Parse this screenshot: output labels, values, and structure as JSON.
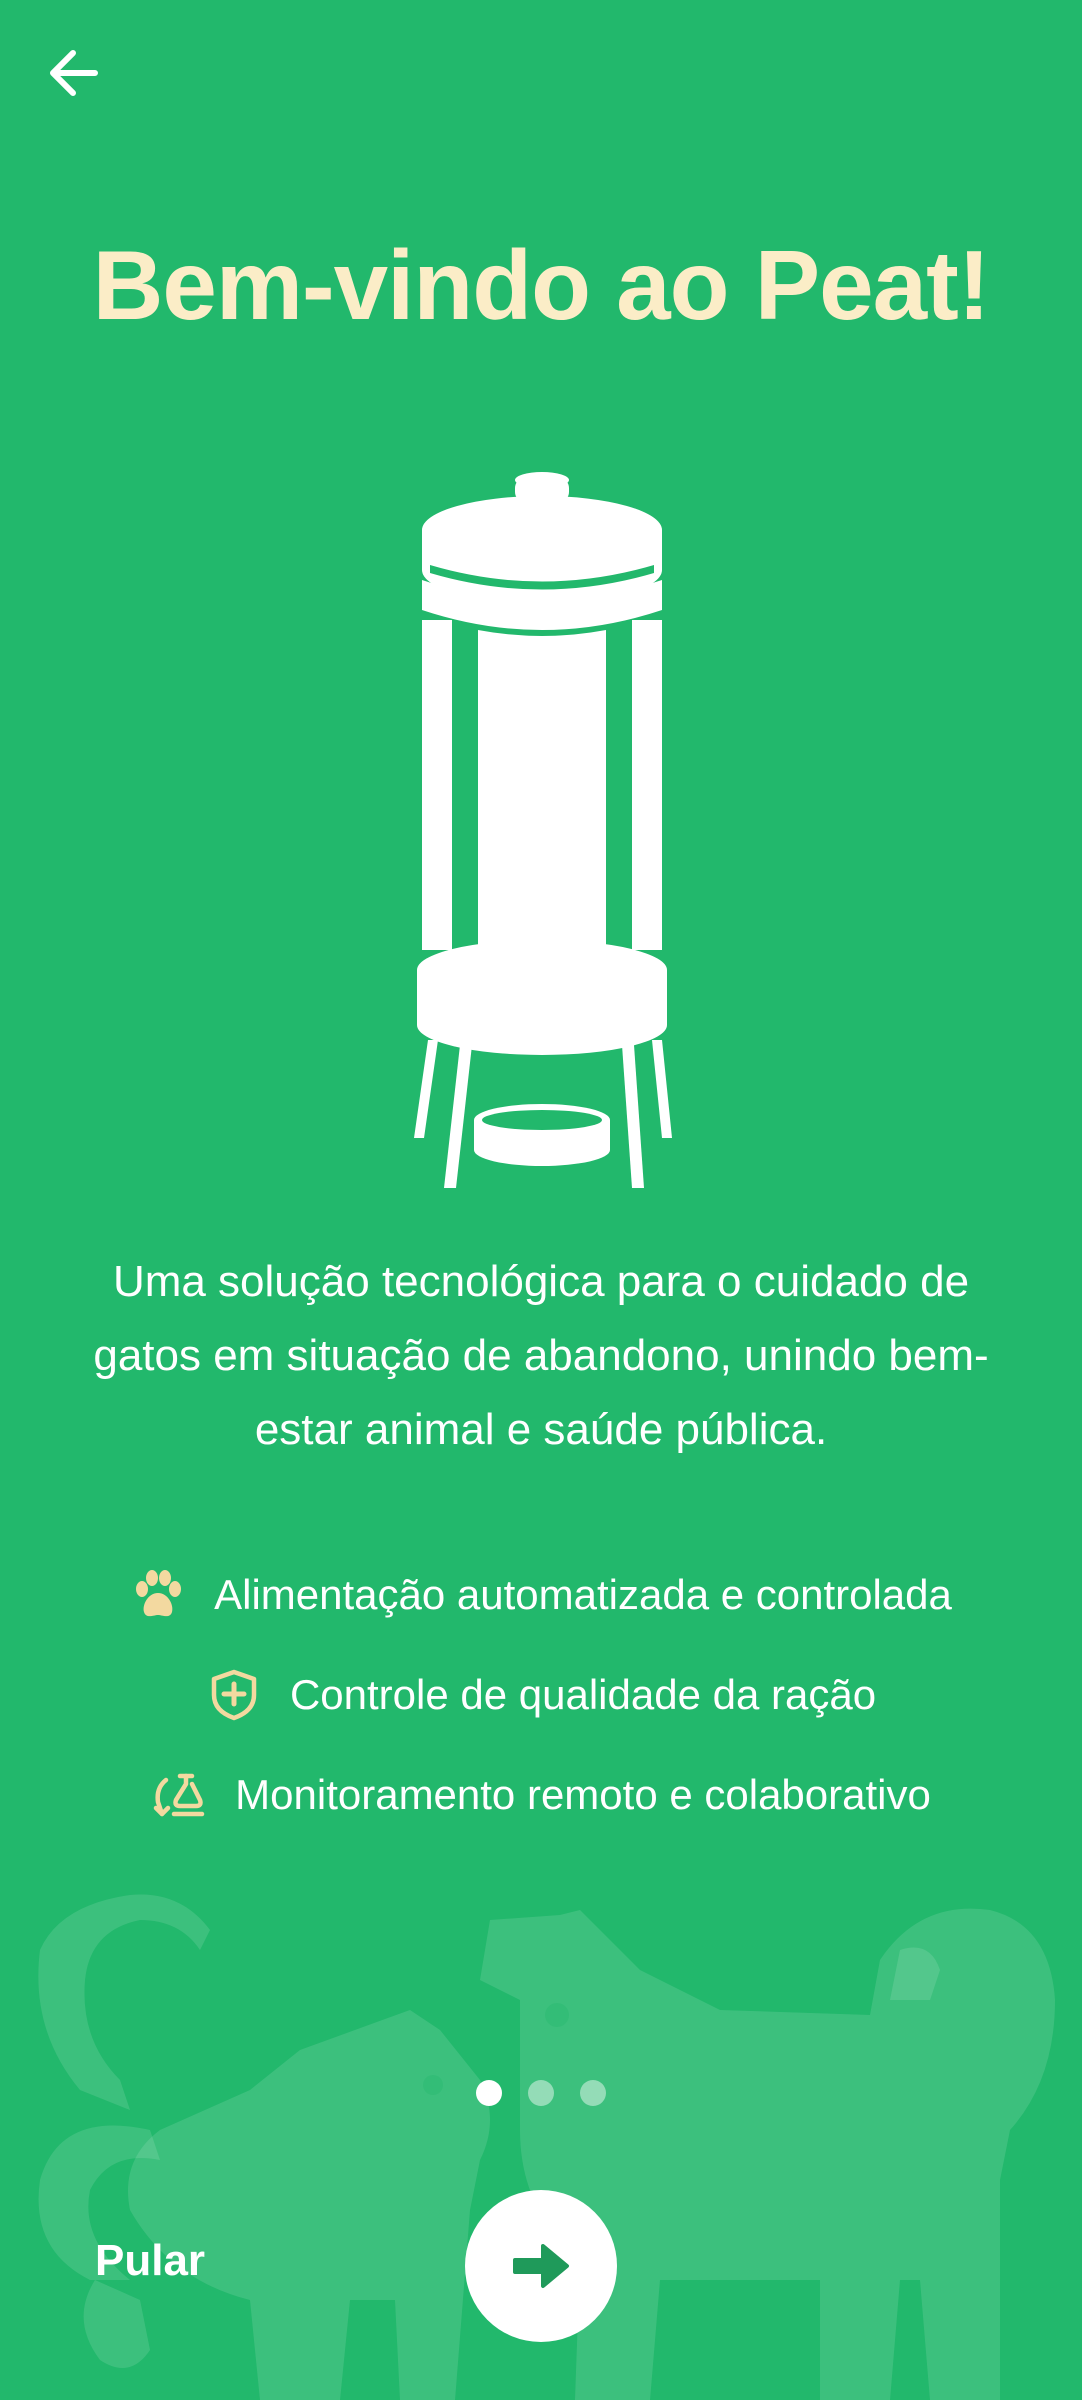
{
  "header": {
    "back_icon": "arrow-left-icon"
  },
  "welcome": {
    "title": "Bem-vindo ao Peat!",
    "illustration": "cat-feeder-illustration",
    "description": "Uma solução tecnológica para o cuidado de gatos em situação de abandono, unindo bem-estar animal e saúde pública."
  },
  "features": [
    {
      "icon": "paw-icon",
      "label": "Alimentação automatizada e controlada"
    },
    {
      "icon": "shield-plus-icon",
      "label": "Controle de qualidade da ração"
    },
    {
      "icon": "remote-monitoring-icon",
      "label": "Monitoramento remoto e colaborativo"
    }
  ],
  "pagination": {
    "current_page": 1,
    "total_pages": 3
  },
  "footer": {
    "skip_label": "Pular",
    "next_icon": "arrow-right-icon"
  },
  "colors": {
    "background": "#22b86c",
    "title": "#fbedc7",
    "accent": "#f3d9a0",
    "text": "#ffffff"
  }
}
